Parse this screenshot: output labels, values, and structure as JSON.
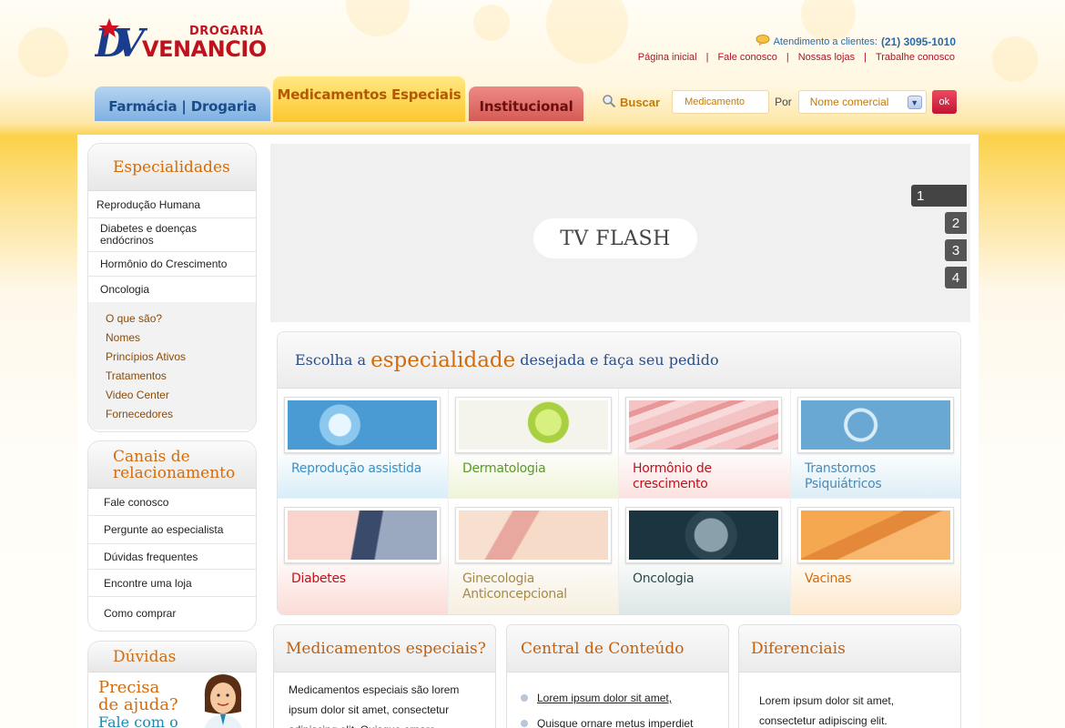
{
  "header": {
    "logo": {
      "line1": "DROGARIA",
      "line2": "VENANCIO",
      "monogram": "DV"
    },
    "contact": {
      "label": "Atendimento a clientes:",
      "phone": "(21) 3095-1010",
      "icon": "speech-bubble-icon"
    },
    "links": [
      "Página inicial",
      "Fale conosco",
      "Nossas lojas",
      "Trabalhe conosco"
    ]
  },
  "tabs": [
    {
      "label": "Farmácia | Drogaria",
      "color": "#7fb0e2"
    },
    {
      "label": "Medicamentos Especiais",
      "color": "#fcc72c",
      "active": true
    },
    {
      "label": "Institucional",
      "color": "#d55b55"
    }
  ],
  "search": {
    "label": "Buscar",
    "icon": "magnifier-icon",
    "input_value": "Medicamento",
    "por_label": "Por",
    "select_value": "Nome comercial",
    "ok_label": "ok"
  },
  "sidebar": {
    "especialidades": {
      "title": "Especialidades",
      "items": [
        "Reprodução Humana",
        "Diabetes e doenças endócrinos",
        "Hormônio do Crescimento",
        "Oncologia"
      ],
      "subitems": [
        "O que são?",
        "Nomes",
        "Princípios Ativos",
        "Tratamentos",
        "Video Center",
        "Fornecedores"
      ]
    },
    "canais": {
      "title": "Canais de relacionamento",
      "items": [
        "Fale conosco",
        "Pergunte ao especialista",
        "Dúvidas frequentes",
        "Encontre uma loja",
        "Como comprar"
      ]
    },
    "duvidas": {
      "title": "Dúvidas",
      "promo_line1": "Precisa",
      "promo_line2": "de ajuda?",
      "promo_line3": "Fale com o"
    }
  },
  "tv": {
    "label": "TV FLASH",
    "slides": [
      "1",
      "2",
      "3",
      "4"
    ],
    "active_slide": "1"
  },
  "specialties_panel": {
    "title_pre": "Escolha a",
    "title_big": "especialidade",
    "title_post": "desejada e faça seu pedido",
    "cells": [
      {
        "name": "Reprodução assistida",
        "color": "#3a8fc4",
        "bg": "#d8eef8"
      },
      {
        "name": "Dermatologia",
        "color": "#5a9a2a",
        "bg": "#eef4d8"
      },
      {
        "name": "Hormônio de crescimento",
        "color": "#c0121e",
        "bg": "#fbe2e0"
      },
      {
        "name": "Transtornos Psiquiátricos",
        "color": "#4a8ab4",
        "bg": "#ddeef6"
      },
      {
        "name": "Diabetes",
        "color": "#c0121e",
        "bg": "#fbdcd6"
      },
      {
        "name": "Ginecologia Anticoncepcional",
        "color": "#a68a4a",
        "bg": "#f6efe0"
      },
      {
        "name": "Oncologia",
        "color": "#2e4a4a",
        "bg": "#dde6e6"
      },
      {
        "name": "Vacinas",
        "color": "#d46b0a",
        "bg": "#fde8cc"
      }
    ]
  },
  "bottom": {
    "medicamentos": {
      "title": "Medicamentos especiais?",
      "text": "Medicamentos especiais são lorem ipsum dolor sit amet, consectetur adipiscing elit. Quisque ornare"
    },
    "central": {
      "title": "Central de Conteúdo",
      "items": [
        "Lorem ipsum dolor sit amet,",
        "Quisque ornare metus imperdiet"
      ]
    },
    "diferenciais": {
      "title": "Diferenciais",
      "text": "Lorem ipsum dolor sit amet, consectetur adipiscing elit."
    }
  }
}
